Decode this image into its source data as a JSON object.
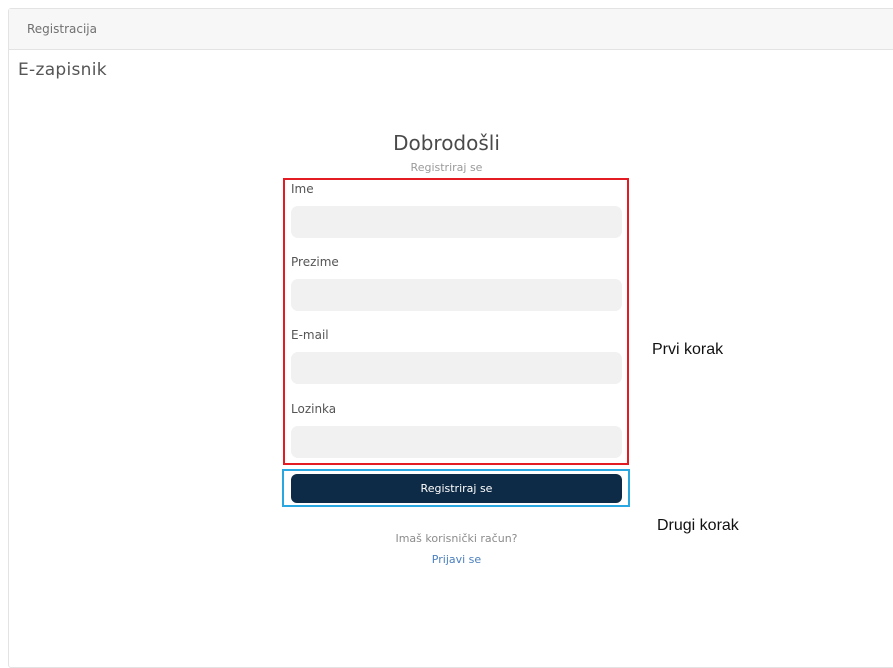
{
  "tab": {
    "label": "Registracija"
  },
  "app": {
    "title": "E-zapisnik"
  },
  "form": {
    "heading": "Dobrodošli",
    "subtitle": "Registriraj se",
    "fields": [
      {
        "label": "Ime",
        "value": ""
      },
      {
        "label": "Prezime",
        "value": ""
      },
      {
        "label": "E-mail",
        "value": ""
      },
      {
        "label": "Lozinka",
        "value": ""
      }
    ],
    "submit_label": "Registriraj se",
    "have_account_text": "Imaš korisnički račun?",
    "login_link": "Prijavi se"
  },
  "annotations": {
    "step1": "Prvi korak",
    "step2": "Drugi korak"
  },
  "colors": {
    "step1_box": "#e31b23",
    "step2_box": "#2aa7e0",
    "button": "#0d2b46",
    "link": "#4a7fbf"
  }
}
